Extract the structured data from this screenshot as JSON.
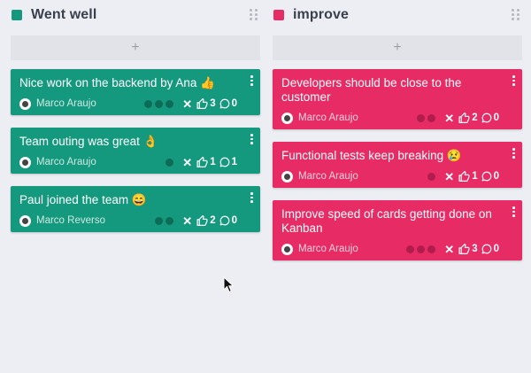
{
  "colors": {
    "background": "#eceef3",
    "went_well": "#15997e",
    "improve": "#e72b65",
    "went_well_dot": "#0c6c58",
    "improve_dot": "#b01c4b"
  },
  "columns": [
    {
      "title": "Went well",
      "color": "#15997e",
      "add_label": "+",
      "cards": [
        {
          "text": "Nice work on the backend by Ana 👍",
          "author": "Marco Araujo",
          "likes": "3",
          "comments": "0",
          "dots": 3
        },
        {
          "text": "Team outing was great 👌",
          "author": "Marco Araujo",
          "likes": "1",
          "comments": "1",
          "dots": 1
        },
        {
          "text": "Paul joined the team 😄",
          "author": "Marco Reverso",
          "likes": "2",
          "comments": "0",
          "dots": 2
        }
      ]
    },
    {
      "title": "improve",
      "color": "#e72b65",
      "add_label": "+",
      "cards": [
        {
          "text": "Developers should be close to the customer",
          "author": "Marco Araujo",
          "likes": "2",
          "comments": "0",
          "dots": 2
        },
        {
          "text": "Functional tests keep breaking 😢",
          "author": "Marco Araujo",
          "likes": "1",
          "comments": "0",
          "dots": 1
        },
        {
          "text": "Improve speed of cards getting done on Kanban",
          "author": "Marco Araujo",
          "likes": "3",
          "comments": "0",
          "dots": 3
        }
      ]
    }
  ],
  "icons": {
    "column_drag": "drag-handle-icon",
    "card_menu": "more-vert-icon",
    "remove_vote": "close-icon",
    "like": "thumbs-up-icon",
    "comment": "comment-icon",
    "cursor": "mouse-pointer-icon"
  }
}
